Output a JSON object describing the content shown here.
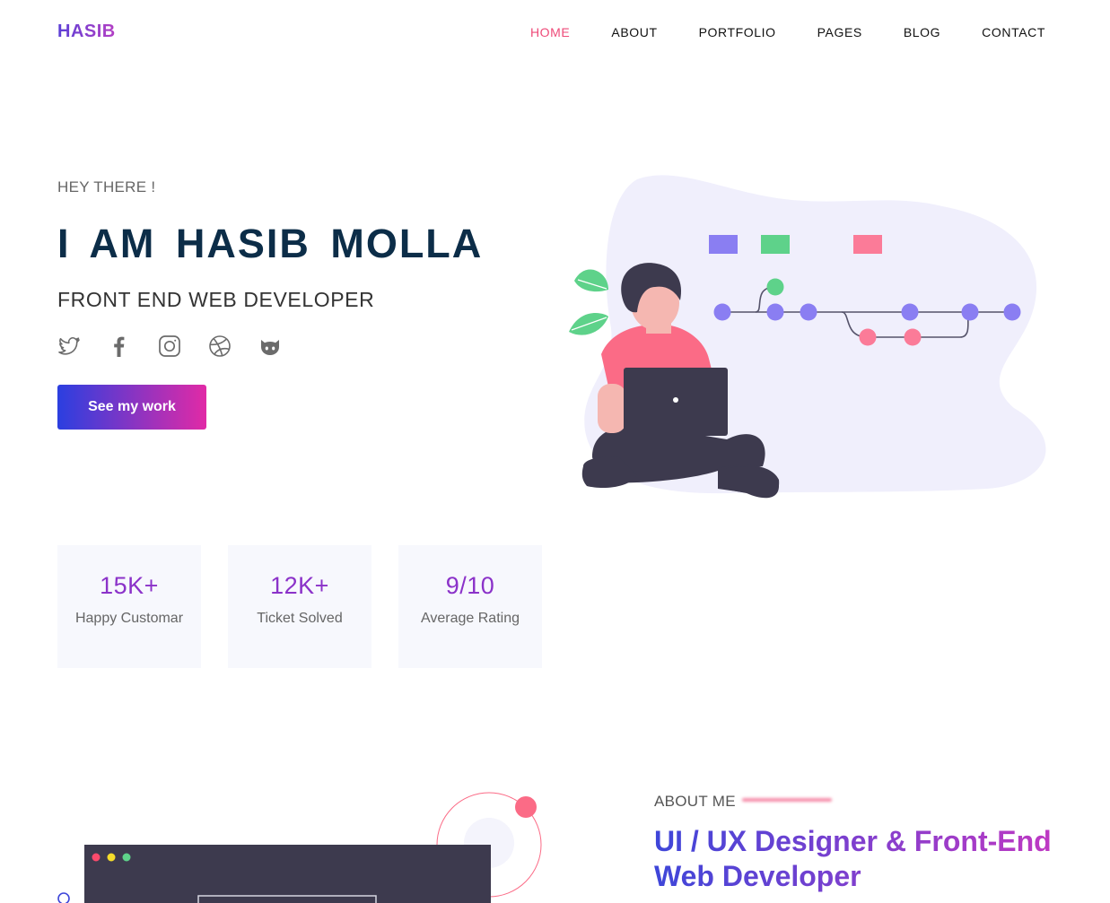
{
  "brand": "HASIB",
  "nav": [
    {
      "label": "HOME",
      "active": true
    },
    {
      "label": "ABOUT",
      "active": false
    },
    {
      "label": "PORTFOLIO",
      "active": false
    },
    {
      "label": "PAGES",
      "active": false
    },
    {
      "label": "BLOG",
      "active": false
    },
    {
      "label": "CONTACT",
      "active": false
    }
  ],
  "hero": {
    "greeting": "HEY THERE !",
    "name": "I AM HASIB MOLLA",
    "role": "FRONT END WEB DEVELOPER",
    "socials": [
      "twitter-icon",
      "facebook-icon",
      "instagram-icon",
      "dribbble-icon",
      "github-icon"
    ],
    "cta": "See my work"
  },
  "stats": [
    {
      "value": "15K+",
      "label": "Happy Customar"
    },
    {
      "value": "12K+",
      "label": "Ticket Solved"
    },
    {
      "value": "9/10",
      "label": "Average Rating"
    }
  ],
  "about": {
    "label": "ABOUT ME",
    "title": "UI / UX Designer & Front-End Web Developer"
  },
  "colors": {
    "accent": "#ee4a78",
    "heading": "#0c2d48",
    "stat_value": "#8b32c9",
    "gradient_start": "#2b3fe0",
    "gradient_end": "#e12aa6"
  }
}
